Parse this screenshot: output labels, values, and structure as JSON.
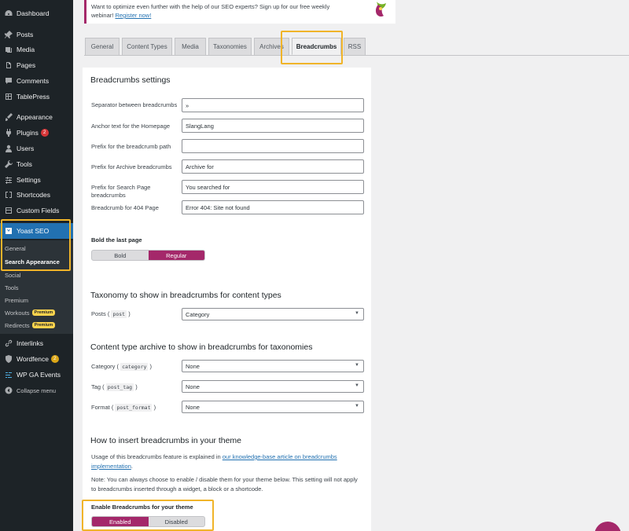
{
  "sidebar": {
    "items": [
      {
        "label": "Dashboard",
        "icon": "dashboard-icon"
      },
      {
        "label": "Posts",
        "icon": "pin-icon"
      },
      {
        "label": "Media",
        "icon": "media-icon"
      },
      {
        "label": "Pages",
        "icon": "pages-icon"
      },
      {
        "label": "Comments",
        "icon": "comment-icon"
      },
      {
        "label": "TablePress",
        "icon": "table-icon"
      },
      {
        "label": "Appearance",
        "icon": "brush-icon"
      },
      {
        "label": "Plugins",
        "icon": "plugin-icon",
        "badge": "2"
      },
      {
        "label": "Users",
        "icon": "user-icon"
      },
      {
        "label": "Tools",
        "icon": "wrench-icon"
      },
      {
        "label": "Settings",
        "icon": "settings-icon"
      },
      {
        "label": "Shortcodes",
        "icon": "brackets-icon"
      },
      {
        "label": "Custom Fields",
        "icon": "fields-icon"
      },
      {
        "label": "Yoast SEO",
        "icon": "yoast-icon"
      }
    ],
    "submenu": [
      {
        "label": "General"
      },
      {
        "label": "Search Appearance"
      },
      {
        "label": "Social"
      },
      {
        "label": "Tools"
      },
      {
        "label": "Premium"
      },
      {
        "label": "Workouts",
        "badge": "Premium"
      },
      {
        "label": "Redirects",
        "badge": "Premium"
      }
    ],
    "bottom_items": [
      {
        "label": "Interlinks",
        "icon": "link-icon"
      },
      {
        "label": "Wordfence",
        "icon": "shield-icon",
        "badge": "2"
      },
      {
        "label": "WP GA Events",
        "icon": "events-icon"
      },
      {
        "label": "Collapse menu",
        "icon": "collapse-icon"
      }
    ]
  },
  "notice": {
    "text": "Want to optimize even further with the help of our SEO experts? Sign up for our free weekly webinar!",
    "link": "Register now!"
  },
  "tabs": [
    {
      "label": "General"
    },
    {
      "label": "Content Types"
    },
    {
      "label": "Media"
    },
    {
      "label": "Taxonomies"
    },
    {
      "label": "Archives"
    },
    {
      "label": "Breadcrumbs"
    },
    {
      "label": "RSS"
    }
  ],
  "breadcrumbs_settings": {
    "title": "Breadcrumbs settings",
    "fields": [
      {
        "label": "Separator between breadcrumbs",
        "value": "»"
      },
      {
        "label": "Anchor text for the Homepage",
        "value": "SlangLang"
      },
      {
        "label": "Prefix for the breadcrumb path",
        "value": ""
      },
      {
        "label": "Prefix for Archive breadcrumbs",
        "value": "Archive for"
      },
      {
        "label": "Prefix for Search Page breadcrumbs",
        "value": "You searched for"
      },
      {
        "label": "Breadcrumb for 404 Page",
        "value": "Error 404: Site not found"
      }
    ],
    "bold_last_page": {
      "label": "Bold the last page",
      "options": [
        "Bold",
        "Regular"
      ],
      "selected": "Regular"
    }
  },
  "taxonomy_section": {
    "title": "Taxonomy to show in breadcrumbs for content types",
    "rows": [
      {
        "label": "Posts (",
        "code": "post",
        "suffix": ")",
        "value": "Category"
      }
    ]
  },
  "archive_section": {
    "title": "Content type archive to show in breadcrumbs for taxonomies",
    "rows": [
      {
        "label": "Category (",
        "code": "category",
        "suffix": ")",
        "value": "None"
      },
      {
        "label": "Tag (",
        "code": "post_tag",
        "suffix": ")",
        "value": "None"
      },
      {
        "label": "Format (",
        "code": "post_format",
        "suffix": ")",
        "value": "None"
      }
    ]
  },
  "insert_section": {
    "title": "How to insert breadcrumbs in your theme",
    "usage_text": "Usage of this breadcrumbs feature is explained in ",
    "usage_link": "our knowledge-base article on breadcrumbs implementation",
    "usage_end": ".",
    "note": "Note: You can always choose to enable / disable them for your theme below. This setting will not apply to breadcrumbs inserted through a widget, a block or a shortcode.",
    "enable_label": "Enable Breadcrumbs for your theme",
    "options": [
      "Enabled",
      "Disabled"
    ],
    "selected": "Enabled"
  },
  "colors": {
    "accent": "#a4286a",
    "highlight": "#f0b429",
    "wp_blue": "#2271b1",
    "sidebar": "#1d2327"
  }
}
